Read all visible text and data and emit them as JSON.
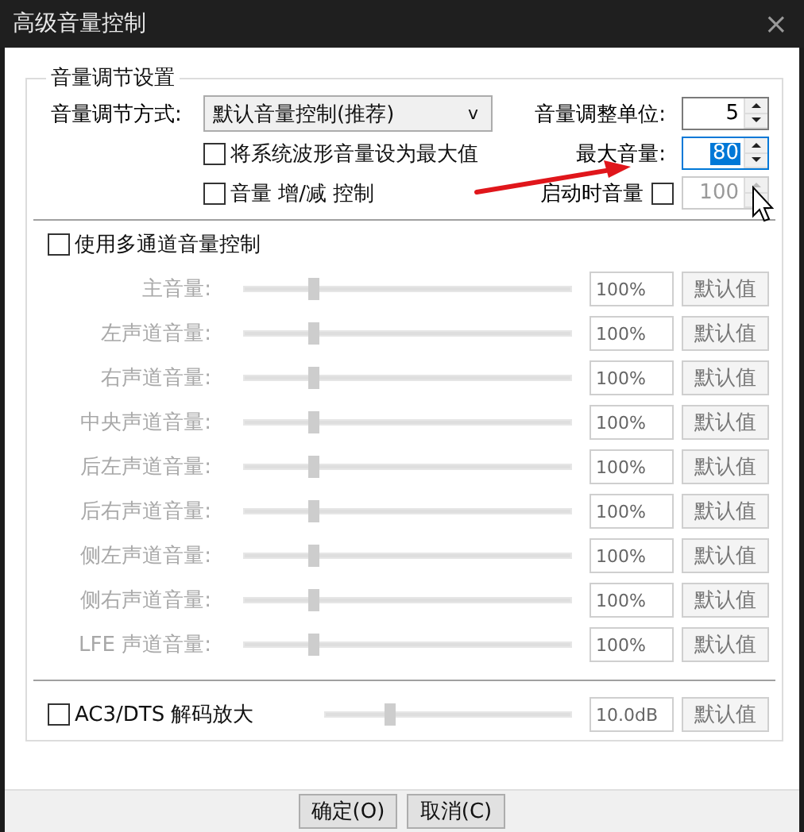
{
  "window": {
    "title": "高级音量控制",
    "close_button": "×"
  },
  "group": {
    "title": "音量调节设置",
    "mode": {
      "label": "音量调节方式:",
      "value": "默认音量控制(推荐)",
      "caret": "v"
    },
    "options": [
      {
        "label": "将系统波形音量设为最大值",
        "checked": false
      },
      {
        "label": "音量 增/减 控制",
        "checked": false
      }
    ],
    "step": {
      "label": "音量调整单位:",
      "value": "5",
      "selected": false,
      "disabled": false
    },
    "max_volume": {
      "label": "最大音量:",
      "value": "80",
      "selected": true,
      "disabled": false
    },
    "startup_volume": {
      "label": "启动时音量",
      "checked": false,
      "value": "100",
      "selected": false,
      "disabled": true
    },
    "multichannel": {
      "label": "使用多通道音量控制",
      "checked": false
    },
    "channels": [
      {
        "name": "主音量:",
        "level": 0.21,
        "value": "100%",
        "button": "默认值"
      },
      {
        "name": "左声道音量:",
        "level": 0.21,
        "value": "100%",
        "button": "默认值"
      },
      {
        "name": "右声道音量:",
        "level": 0.21,
        "value": "100%",
        "button": "默认值"
      },
      {
        "name": "中央声道音量:",
        "level": 0.21,
        "value": "100%",
        "button": "默认值"
      },
      {
        "name": "后左声道音量:",
        "level": 0.21,
        "value": "100%",
        "button": "默认值"
      },
      {
        "name": "后右声道音量:",
        "level": 0.21,
        "value": "100%",
        "button": "默认值"
      },
      {
        "name": "侧左声道音量:",
        "level": 0.21,
        "value": "100%",
        "button": "默认值"
      },
      {
        "name": "侧右声道音量:",
        "level": 0.21,
        "value": "100%",
        "button": "默认值"
      },
      {
        "name": "LFE 声道音量:",
        "level": 0.21,
        "value": "100%",
        "button": "默认值"
      }
    ],
    "ac3": {
      "label": "AC3/DTS 解码放大",
      "checked": false,
      "level": 0.26,
      "value": "10.0dB",
      "button": "默认值"
    }
  },
  "buttons": [
    {
      "label": "确定(O)"
    },
    {
      "label": "取消(C)"
    }
  ]
}
